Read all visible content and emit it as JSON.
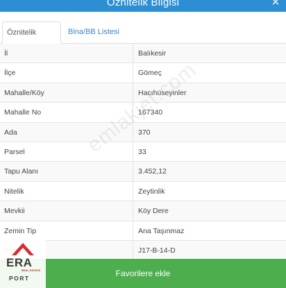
{
  "dialog": {
    "title": "Öznitelik Bilgisi",
    "close_glyph": "✕"
  },
  "tabs": [
    {
      "label": "Öznitelik Bilgisi",
      "active": true
    },
    {
      "label": "Bina/BB Listesi",
      "active": false
    }
  ],
  "attributes": [
    {
      "key": "İl",
      "value": "Balıkesir"
    },
    {
      "key": "İlçe",
      "value": "Gömeç"
    },
    {
      "key": "Mahalle/Köy",
      "value": "Hacıhüseyinler"
    },
    {
      "key": "Mahalle No",
      "value": "167340"
    },
    {
      "key": "Ada",
      "value": "370"
    },
    {
      "key": "Parsel",
      "value": "33"
    },
    {
      "key": "Tapu Alanı",
      "value": "3.452,12"
    },
    {
      "key": "Nitelik",
      "value": "Zeytinlik"
    },
    {
      "key": "Mevkii",
      "value": "Köy Dere"
    },
    {
      "key": "Zemin Tip",
      "value": "Ana Taşınmaz"
    },
    {
      "key": "Pafta",
      "value": "J17-B-14-D"
    }
  ],
  "footer": {
    "button_label": "Favorilere ekle"
  },
  "watermark": {
    "text": "emlakjet.com"
  },
  "logo": {
    "main": "ERA",
    "sub1": "REAL ESTATE",
    "sub2": "PORT"
  },
  "colors": {
    "header": "#2c8fd4",
    "footer_button": "#4cae4c",
    "tab_link": "#3b87c6",
    "logo_red": "#d32f2f"
  }
}
